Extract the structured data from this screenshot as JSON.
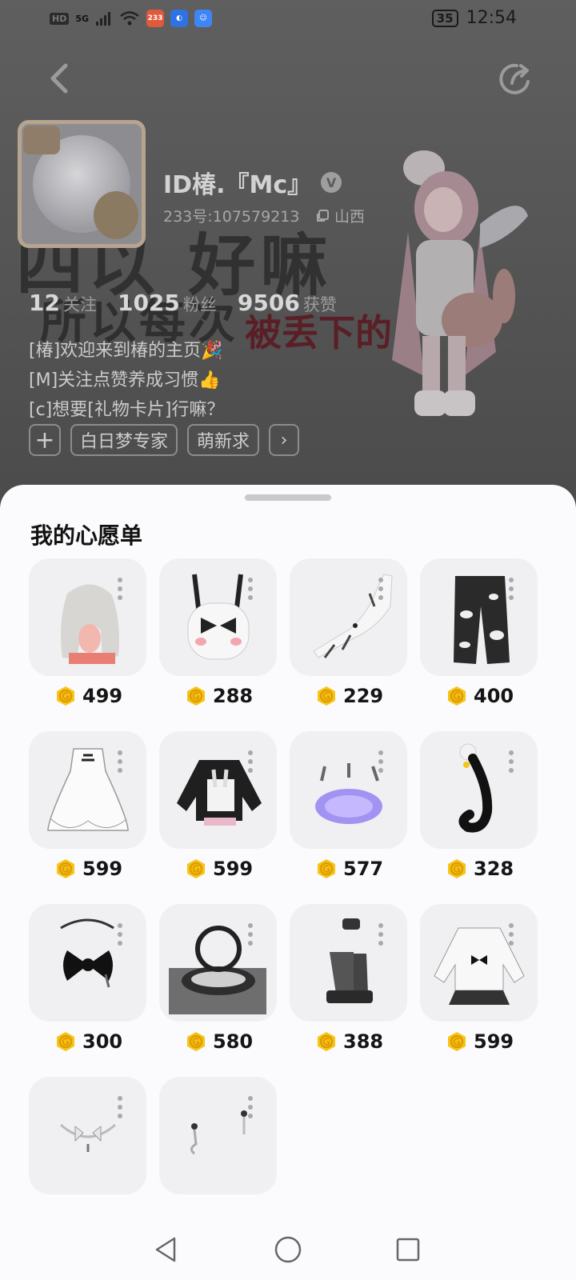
{
  "status_bar": {
    "left_chips": [
      "HD",
      "5G"
    ],
    "app_badge_1": "233",
    "battery": "35",
    "time": "12:54"
  },
  "profile": {
    "username": "ID椿.『Mc』",
    "verified_icon": "V",
    "uid": "233号:107579213",
    "location": "山西",
    "stats": [
      {
        "num": "12",
        "label": "关注"
      },
      {
        "num": "1025",
        "label": "粉丝"
      },
      {
        "num": "9506",
        "label": "获赞"
      }
    ],
    "bio": [
      "[椿]欢迎来到椿的主页🎉",
      "[M]关注点赞养成习惯👍",
      "[c]想要[礼物卡片]行嘛？"
    ],
    "tags": [
      "白日梦专家",
      "萌新求"
    ],
    "bg_text_1": "四以 好嘛",
    "bg_text_2": "所以每次",
    "bg_text_red": "被丢下的"
  },
  "wishlist": {
    "title": "我的心愿单",
    "items": [
      {
        "price": "499",
        "icon": "wig-icon"
      },
      {
        "price": "288",
        "icon": "backpack-icon"
      },
      {
        "price": "229",
        "icon": "gloves-icon"
      },
      {
        "price": "400",
        "icon": "pants-icon"
      },
      {
        "price": "599",
        "icon": "dress-icon"
      },
      {
        "price": "599",
        "icon": "jacket-icon"
      },
      {
        "price": "577",
        "icon": "aura-icon"
      },
      {
        "price": "328",
        "icon": "tail-icon"
      },
      {
        "price": "300",
        "icon": "bow-accessory-icon"
      },
      {
        "price": "580",
        "icon": "halo-effect-icon"
      },
      {
        "price": "388",
        "icon": "boots-icon"
      },
      {
        "price": "599",
        "icon": "sweater-skirt-icon"
      },
      {
        "price": "",
        "icon": "necklace-icon"
      },
      {
        "price": "",
        "icon": "earrings-icon"
      }
    ]
  },
  "colors": {
    "coin": "#f5c518",
    "coin_inner": "#e09b00",
    "card_bg": "#f0f0f3"
  }
}
